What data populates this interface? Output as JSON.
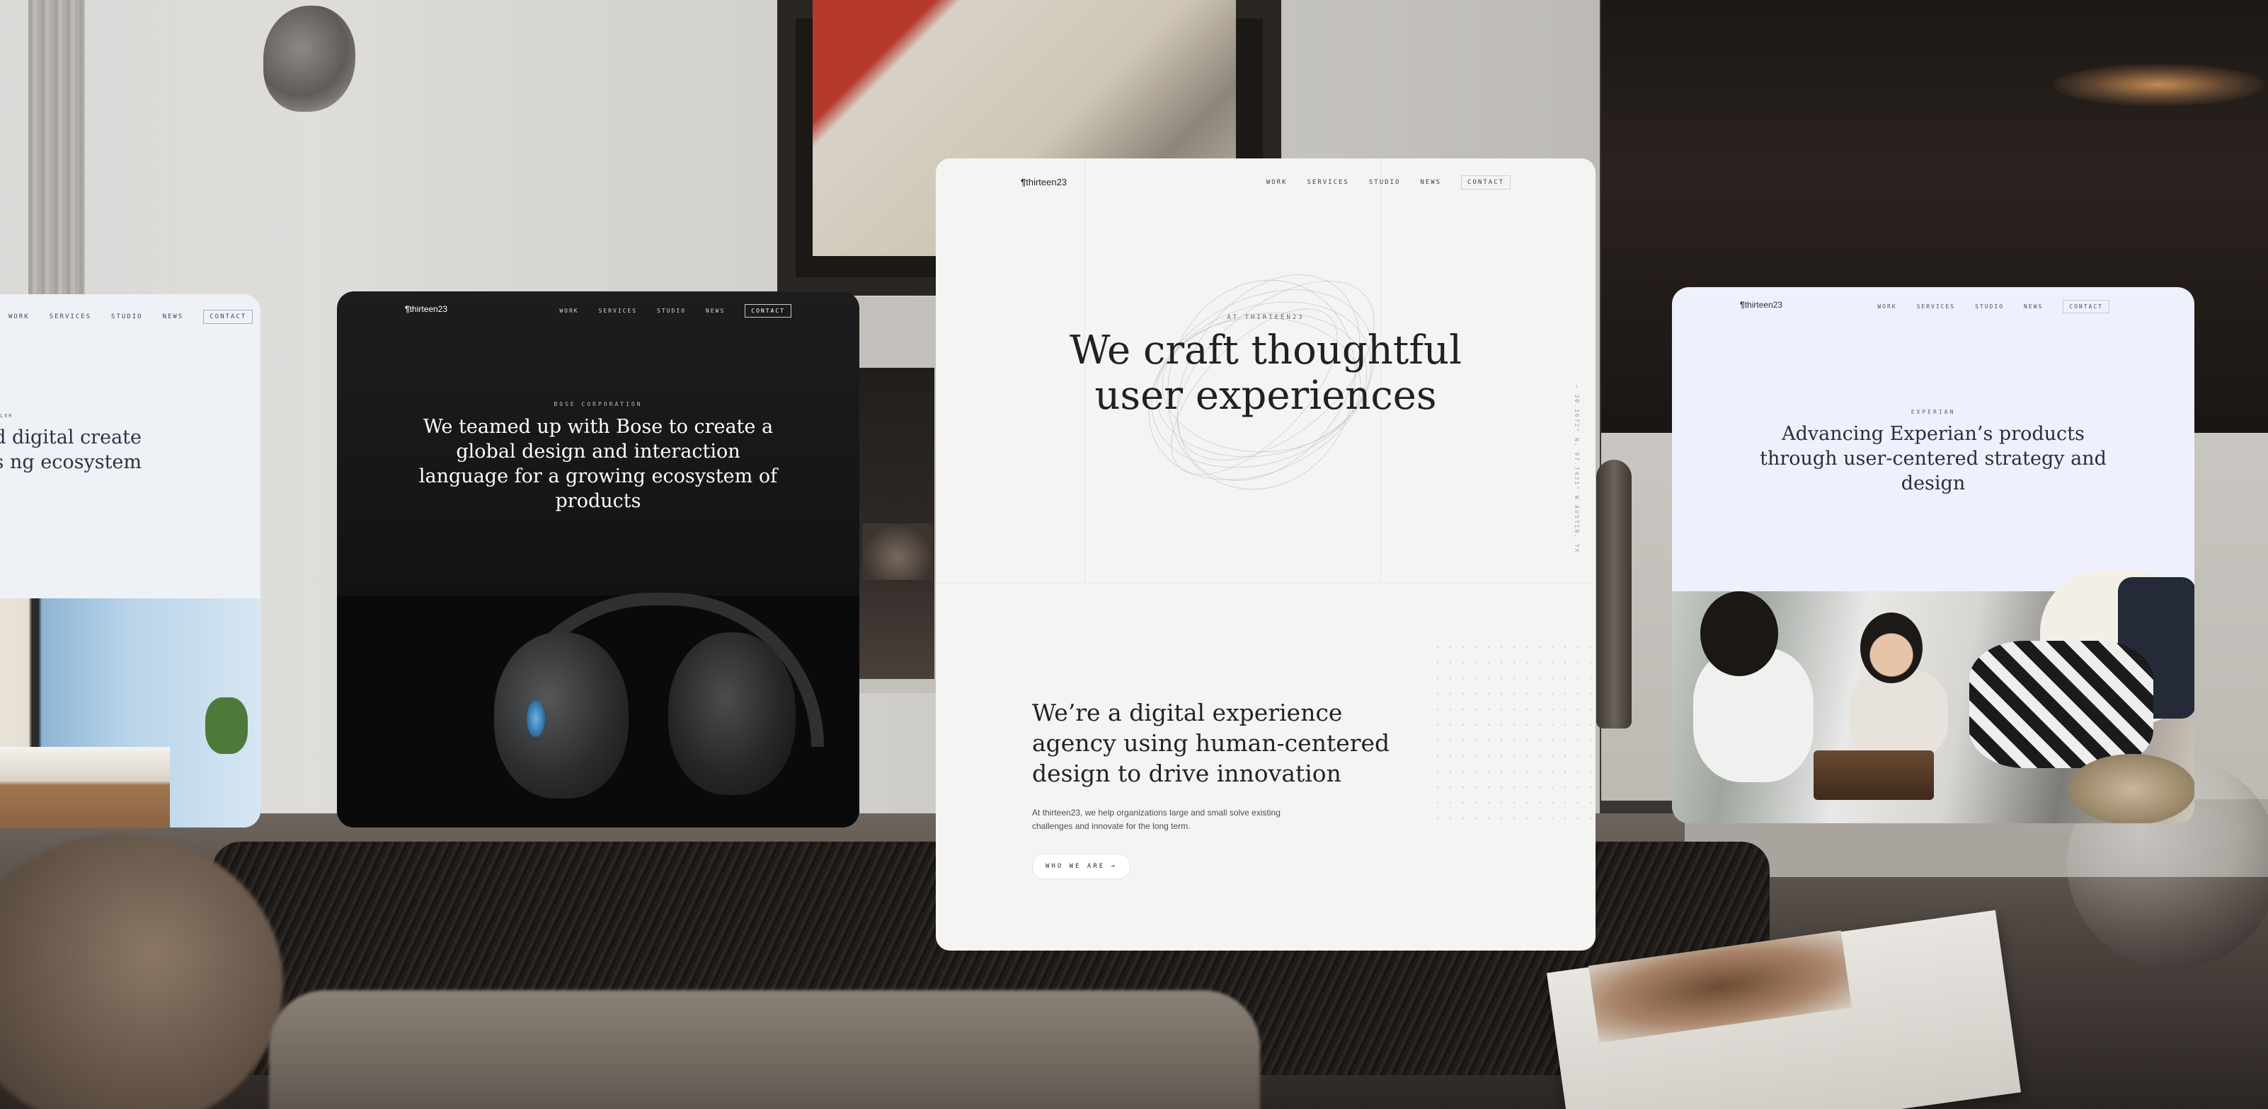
{
  "colors": {
    "main_bg": "#f4f4f3",
    "bose_bg": "#141415",
    "experian_bg": "#eef0fb",
    "kohler_bg": "#eef2f7",
    "ink": "#1e2226"
  },
  "logo_mark": "¶",
  "kohler": {
    "nav": [
      "WORK",
      "SERVICES",
      "STUDIO",
      "NEWS"
    ],
    "contact": "CONTACT",
    "eyebrow": "LER",
    "headline": "sical and digital create Kohler’s ng ecosystem"
  },
  "bose": {
    "logo": "thirteen23",
    "nav": [
      "WORK",
      "SERVICES",
      "STUDIO",
      "NEWS"
    ],
    "contact": "CONTACT",
    "eyebrow": "BOSE CORPORATION",
    "headline": "We teamed up with Bose to create a global design and interaction language for a growing ecosystem of products"
  },
  "main": {
    "logo": "thirteen23",
    "nav": [
      "WORK",
      "SERVICES",
      "STUDIO",
      "NEWS"
    ],
    "contact": "CONTACT",
    "eyebrow": "AT THIRTEEN23",
    "headline": "We craft thoughtful user experiences",
    "vertical_text": "— 30.2672° N, 97.7431° W AUSTIN, TX",
    "subheadline": "We’re a digital experience agency using human-centered design to drive innovation",
    "body": "At thirteen23, we help organizations large and small solve existing challenges and innovate for the long term.",
    "cta": "WHO WE ARE →"
  },
  "experian": {
    "logo": "thirteen23",
    "nav": [
      "WORK",
      "SERVICES",
      "STUDIO",
      "NEWS"
    ],
    "contact": "CONTACT",
    "eyebrow": "EXPERIAN",
    "headline": "Advancing Experian’s products through user-centered strategy and design"
  }
}
